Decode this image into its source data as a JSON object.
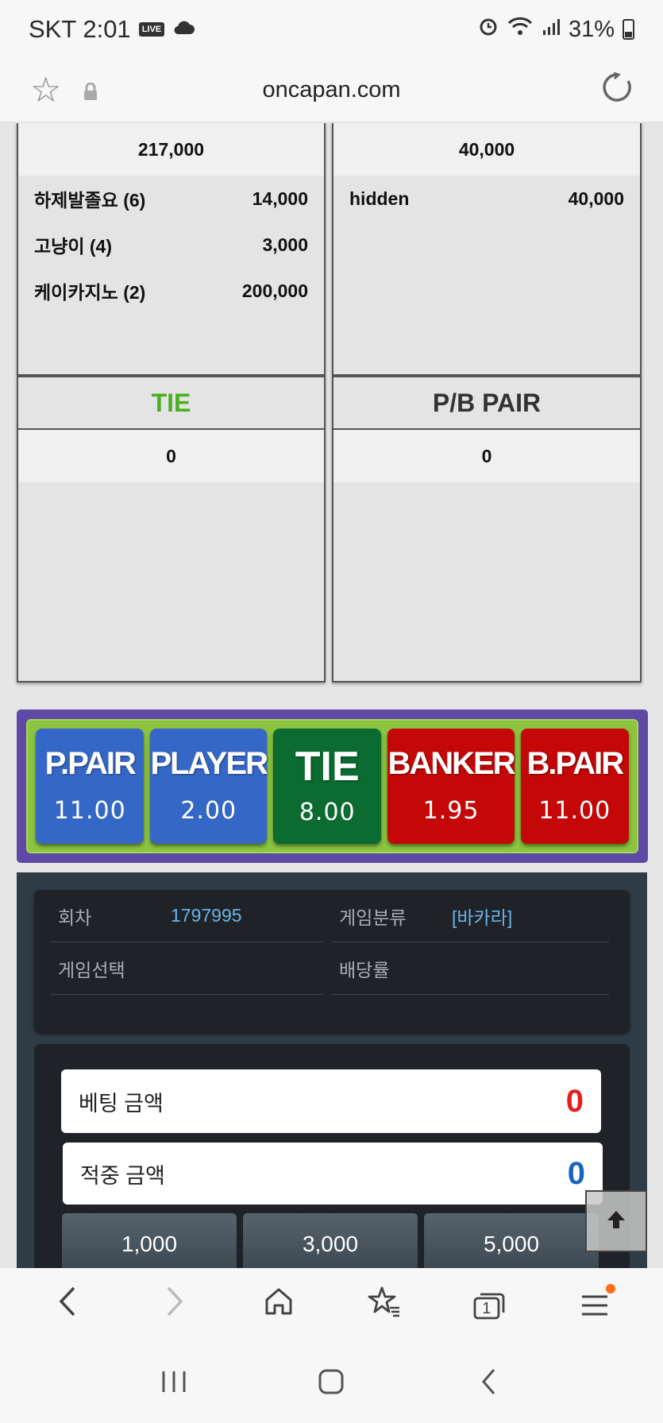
{
  "status_bar": {
    "carrier_time": "SKT 2:01",
    "live_badge": "LIVE",
    "battery": "31%"
  },
  "browser": {
    "url": "oncapan.com"
  },
  "panels": {
    "player": {
      "total": "217,000",
      "rows": [
        {
          "name": "하제발졸요 (6)",
          "amount": "14,000"
        },
        {
          "name": "고냥이 (4)",
          "amount": "3,000"
        },
        {
          "name": "케이카지노 (2)",
          "amount": "200,000"
        }
      ]
    },
    "banker": {
      "total": "40,000",
      "rows": [
        {
          "name": "hidden",
          "amount": "40,000"
        }
      ]
    },
    "tie": {
      "header": "TIE",
      "total": "0",
      "header_color": "#4caf21"
    },
    "pair": {
      "header": "P/B PAIR",
      "total": "0",
      "header_color": "#333333"
    }
  },
  "odds": [
    {
      "label": "P.PAIR",
      "value": "11.00",
      "color": "#3567c6"
    },
    {
      "label": "PLAYER",
      "value": "2.00",
      "color": "#3567c6"
    },
    {
      "label": "TIE",
      "value": "8.00",
      "color": "#0b6b30"
    },
    {
      "label": "BANKER",
      "value": "1.95",
      "color": "#c40707"
    },
    {
      "label": "B.PAIR",
      "value": "11.00",
      "color": "#c40707"
    }
  ],
  "info": {
    "round_label": "회차",
    "round_value": "1797995",
    "category_label": "게임분류",
    "category_value": "[바카라]",
    "selection_label": "게임선택",
    "selection_value": "",
    "odds_label": "배당률",
    "odds_value": ""
  },
  "bet": {
    "bet_amount_label": "베팅 금액",
    "bet_amount_value": "0",
    "win_amount_label": "적중 금액",
    "win_amount_value": "0",
    "chips": [
      "1,000",
      "3,000",
      "5,000"
    ]
  },
  "icons": {
    "bookmark": "star-outline-icon",
    "lock": "lock-icon",
    "reload": "reload-icon",
    "scroll_top": "arrow-up-icon",
    "back": "chevron-left-icon",
    "forward": "chevron-right-icon",
    "home": "home-icon",
    "bookmarks": "star-list-icon",
    "tabs": "tabs-icon",
    "menu": "menu-icon"
  },
  "tabs": {
    "count": "1"
  }
}
